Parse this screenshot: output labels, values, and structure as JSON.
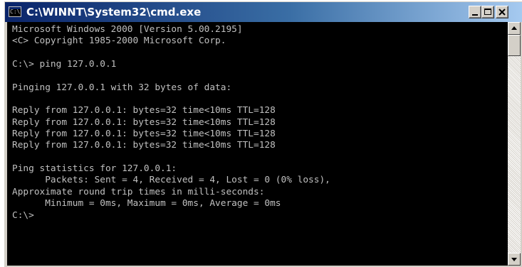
{
  "window": {
    "title": "C:\\WINNT\\System32\\cmd.exe",
    "icon": "command-prompt-icon",
    "icon_text": "C:\\",
    "controls": {
      "minimize": "minimize-icon",
      "maximize": "maximize-icon",
      "close": "close-icon"
    }
  },
  "console": {
    "lines": [
      "Microsoft Windows 2000 [Version 5.00.2195]",
      "<C> Copyright 1985-2000 Microsoft Corp.",
      "",
      "C:\\> ping 127.0.0.1",
      "",
      "Pinging 127.0.0.1 with 32 bytes of data:",
      "",
      "Reply from 127.0.0.1: bytes=32 time<10ms TTL=128",
      "Reply from 127.0.0.1: bytes=32 time<10ms TTL=128",
      "Reply from 127.0.0.1: bytes=32 time<10ms TTL=128",
      "Reply from 127.0.0.1: bytes=32 time<10ms TTL=128",
      "",
      "Ping statistics for 127.0.0.1:",
      "      Packets: Sent = 4, Received = 4, Lost = 0 (0% loss),",
      "Approximate round trip times in milli-seconds:",
      "      Minimum = 0ms, Maximum = 0ms, Average = 0ms",
      "C:\\>"
    ],
    "foreground": "#c0c0c0",
    "background": "#000000"
  },
  "scrollbar": {
    "up": "scroll-up-arrow-icon",
    "down": "scroll-down-arrow-icon"
  },
  "colors": {
    "titlebar_start": "#0a246a",
    "titlebar_end": "#a6caf0",
    "chrome": "#d4d0c8"
  }
}
